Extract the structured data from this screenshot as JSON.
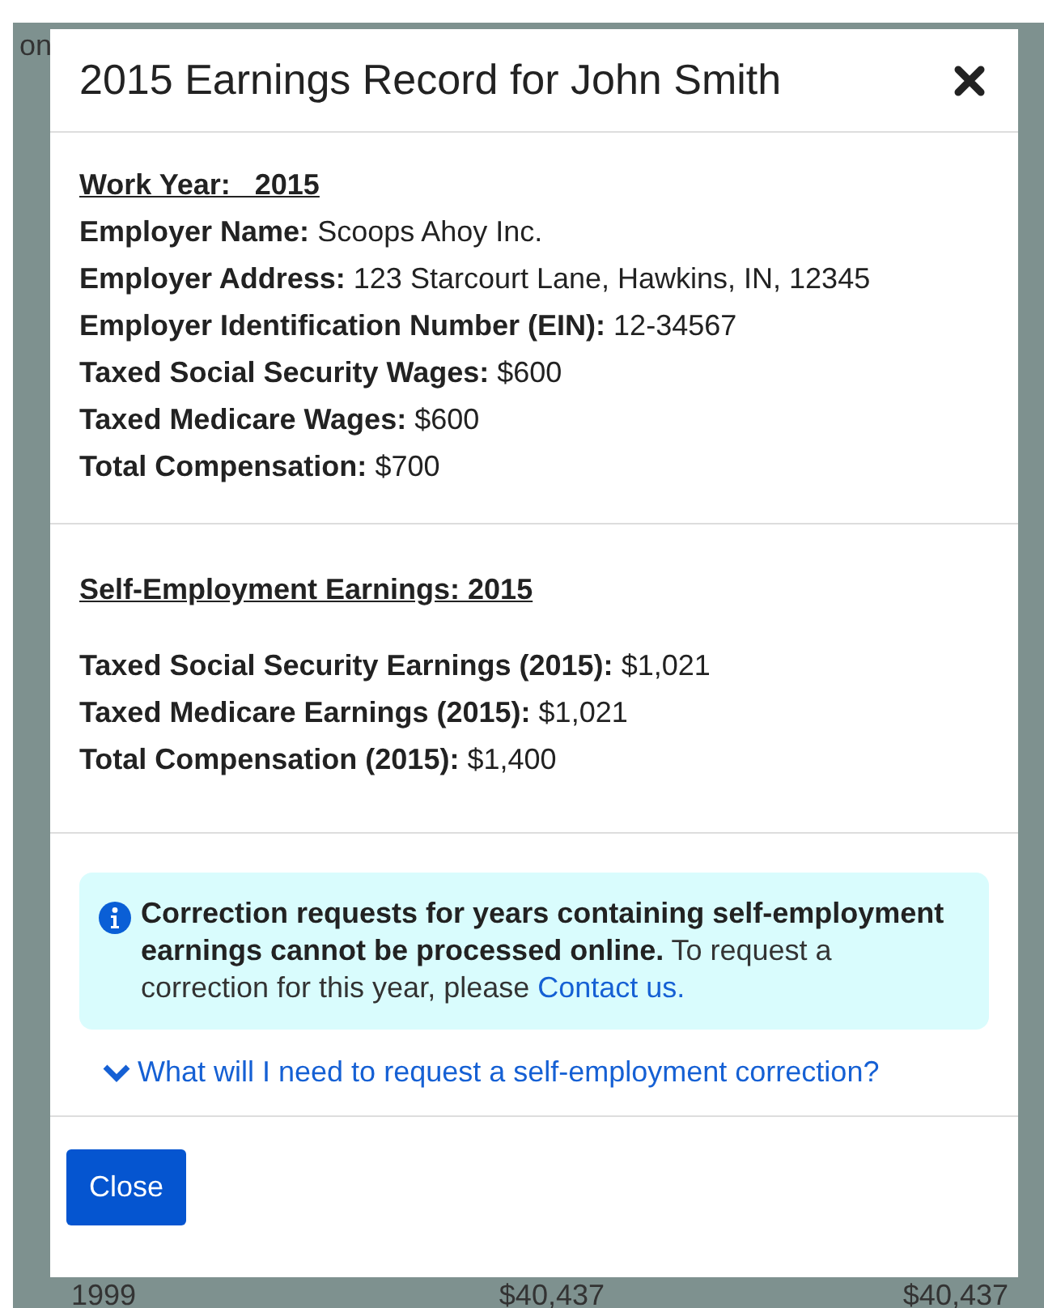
{
  "backdrop": {
    "nav_label": "on",
    "table_row": [
      "1999",
      "$40,437",
      "$40,437"
    ]
  },
  "modal": {
    "title": "2015 Earnings Record for John Smith",
    "employer_section": {
      "heading": "Work Year:   2015",
      "fields": [
        {
          "label": "Employer Name:",
          "value": "Scoops Ahoy Inc."
        },
        {
          "label": "Employer Address:",
          "value": "123 Starcourt Lane, Hawkins, IN, 12345"
        },
        {
          "label": "Employer Identification Number (EIN):",
          "value": "12-34567"
        },
        {
          "label": "Taxed Social Security Wages:",
          "value": "$600"
        },
        {
          "label": "Taxed Medicare Wages:",
          "value": "$600"
        },
        {
          "label": "Total Compensation:",
          "value": "$700"
        }
      ]
    },
    "self_employment_section": {
      "heading": "Self-Employment Earnings: 2015",
      "fields": [
        {
          "label": "Taxed Social Security Earnings (2015):",
          "value": "$1,021"
        },
        {
          "label": "Taxed Medicare Earnings (2015):",
          "value": "$1,021"
        },
        {
          "label": "Total Compensation (2015):",
          "value": "$1,400"
        }
      ]
    },
    "notice": {
      "text": "**Correction requests for years containing self-employment earnings cannot be processed online.** To request a correction for this year, please ",
      "link": "Contact us."
    },
    "disclosure": {
      "label": "What will I need to request a self-employment correction?",
      "expanded": false
    },
    "buttons": [
      "Close"
    ]
  }
}
